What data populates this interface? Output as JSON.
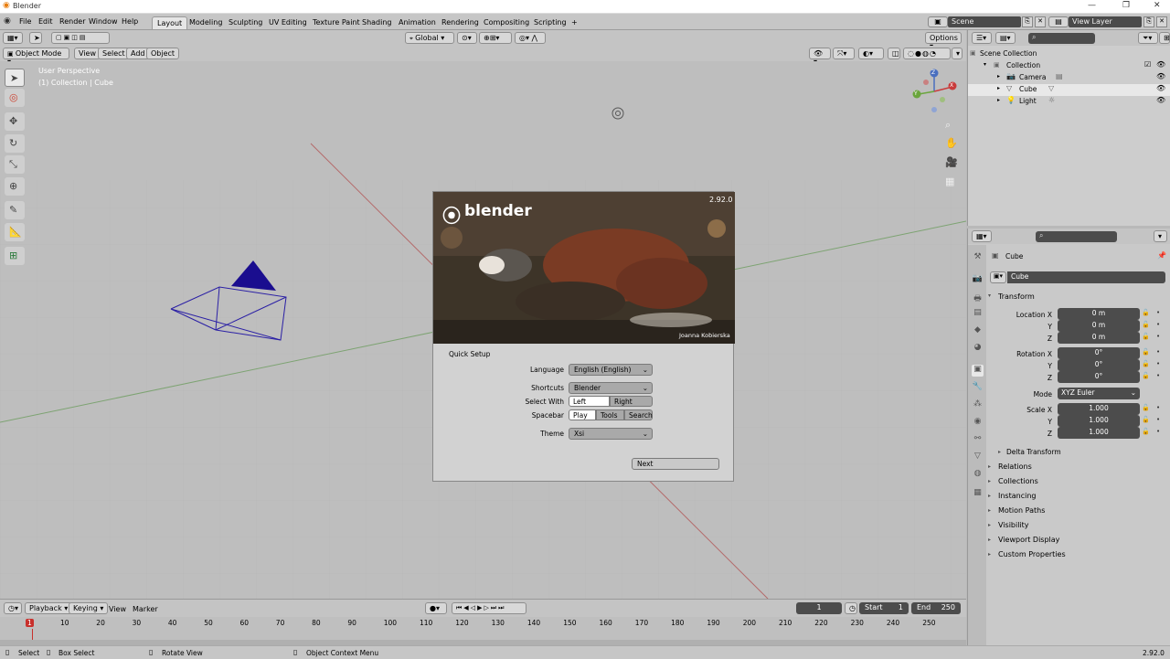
{
  "window": {
    "title": "Blender",
    "min": "—",
    "max": "❐",
    "close": "✕"
  },
  "menu": [
    "File",
    "Edit",
    "Render",
    "Window",
    "Help"
  ],
  "workspaces": [
    "Layout",
    "Modeling",
    "Sculpting",
    "UV Editing",
    "Texture Paint",
    "Shading",
    "Animation",
    "Rendering",
    "Compositing",
    "Scripting",
    "+"
  ],
  "active_workspace": "Layout",
  "scene": {
    "label": "Scene"
  },
  "view_layer": {
    "label": "View Layer"
  },
  "header": {
    "transform_orientation": "Global",
    "options": "Options",
    "mode": "Object Mode",
    "view": "View",
    "select": "Select",
    "add": "Add",
    "object": "Object"
  },
  "viewport": {
    "perspective": "User Perspective",
    "context": "(1) Collection | Cube",
    "axis_x": "X",
    "axis_y": "Y",
    "axis_z": "Z"
  },
  "splash": {
    "logo": "blender",
    "version": "2.92.0",
    "credit": "Joanna Kobierska",
    "title": "Quick Setup",
    "language_label": "Language",
    "language_value": "English (English)",
    "shortcuts_label": "Shortcuts",
    "shortcuts_value": "Blender",
    "select_with_label": "Select With",
    "select_left": "Left",
    "select_right": "Right",
    "spacebar_label": "Spacebar",
    "spacebar_play": "Play",
    "spacebar_tools": "Tools",
    "spacebar_search": "Search",
    "theme_label": "Theme",
    "theme_value": "Xsi",
    "next": "Next"
  },
  "timeline": {
    "playback": "Playback",
    "keying": "Keying",
    "view": "View",
    "marker": "Marker",
    "current_frame": "1",
    "start_label": "Start",
    "start": "1",
    "end_label": "End",
    "end": "250",
    "ticks": [
      "1",
      "10",
      "20",
      "30",
      "40",
      "50",
      "60",
      "70",
      "80",
      "90",
      "100",
      "110",
      "120",
      "130",
      "140",
      "150",
      "160",
      "170",
      "180",
      "190",
      "200",
      "210",
      "220",
      "230",
      "240",
      "250"
    ]
  },
  "status": {
    "select": "Select",
    "box_select": "Box Select",
    "rotate_view": "Rotate View",
    "context_menu": "Object Context Menu",
    "version": "2.92.0"
  },
  "outliner": {
    "scene_collection": "Scene Collection",
    "collection": "Collection",
    "items": [
      "Camera",
      "Cube",
      "Light"
    ]
  },
  "properties": {
    "object_name": "Cube",
    "data_name": "Cube",
    "transform": "Transform",
    "location_x_label": "Location X",
    "y_label": "Y",
    "z_label": "Z",
    "location": [
      "0 m",
      "0 m",
      "0 m"
    ],
    "rotation_x_label": "Rotation X",
    "rotation": [
      "0°",
      "0°",
      "0°"
    ],
    "mode_label": "Mode",
    "mode_value": "XYZ Euler",
    "scale_x_label": "Scale X",
    "scale": [
      "1.000",
      "1.000",
      "1.000"
    ],
    "delta_transform": "Delta Transform",
    "sections": [
      "Relations",
      "Collections",
      "Instancing",
      "Motion Paths",
      "Visibility",
      "Viewport Display",
      "Custom Properties"
    ]
  },
  "colors": {
    "accent_blue": "#4772b3",
    "viewport_bg": "#bebebe",
    "camera_blue": "#1a0d8f",
    "frame_red": "#c8302c"
  }
}
